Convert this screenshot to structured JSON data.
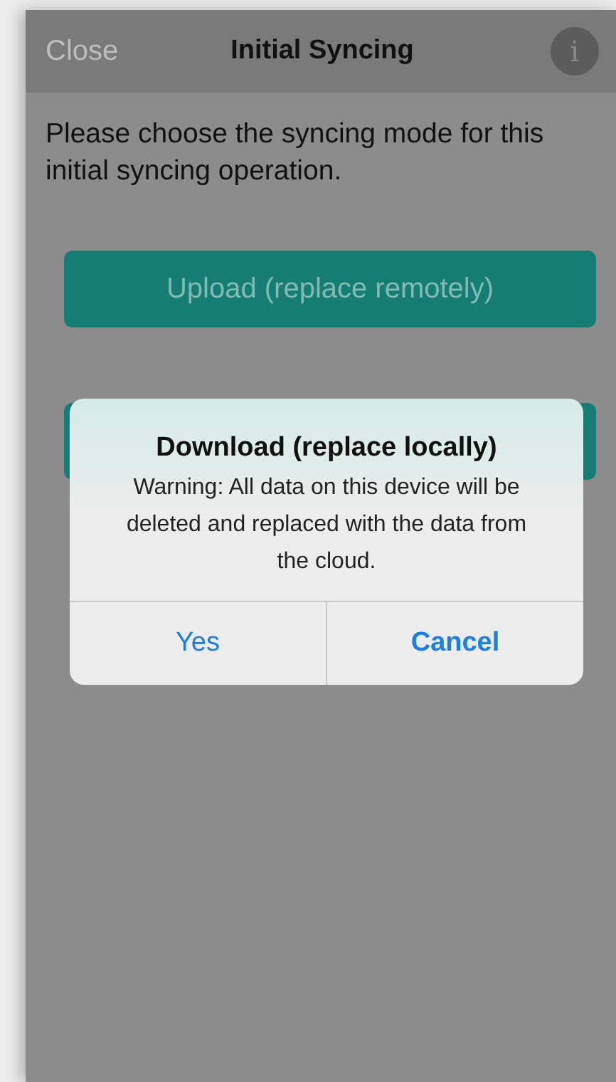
{
  "nav_bar": {
    "left_button": "Close",
    "title": "Initial Syncing",
    "info_button": "i"
  },
  "prompt": "Please choose the syncing mode for this initial syncing operation.",
  "mode_buttons": [
    {
      "label": "Upload (replace remotely)"
    }
  ],
  "alert": {
    "title": "Download (replace locally)",
    "message": "Warning: All data on this device will be deleted and replaced with the data from the cloud.",
    "buttons": [
      {
        "label": "Yes",
        "kind": "normal"
      },
      {
        "label": "Cancel",
        "kind": "preferred"
      }
    ]
  }
}
